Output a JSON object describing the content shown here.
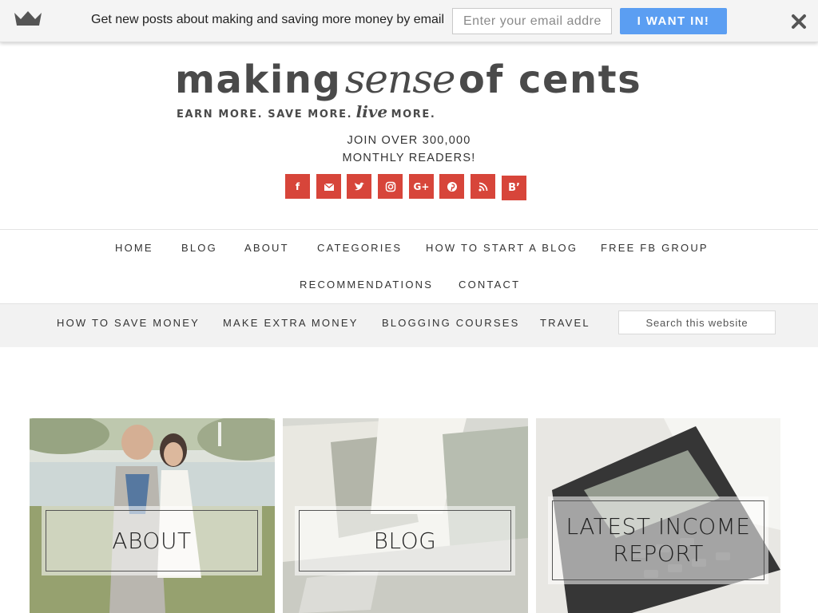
{
  "optin": {
    "text": "Get new posts about making and saving more money by email",
    "email_placeholder": "Enter your email address",
    "button_label": "I WANT IN!"
  },
  "logo": {
    "word1": "making",
    "word2": "sense",
    "word3": "of cents",
    "tag1": "EARN MORE. SAVE MORE.",
    "tag2": "live",
    "tag3": "MORE."
  },
  "readers": {
    "line1": "JOIN OVER 300,000",
    "line2": "MONTHLY READERS!"
  },
  "social": [
    {
      "icon": "facebook-icon",
      "text": "f"
    },
    {
      "icon": "email-icon",
      "text": ""
    },
    {
      "icon": "twitter-icon",
      "text": ""
    },
    {
      "icon": "instagram-icon",
      "text": ""
    },
    {
      "icon": "google-plus-icon",
      "text": "G+"
    },
    {
      "icon": "pinterest-icon",
      "text": ""
    },
    {
      "icon": "rss-icon",
      "text": ""
    },
    {
      "icon": "bloglovin-icon",
      "text": "B’"
    }
  ],
  "nav": {
    "home": "Home",
    "blog": "Blog",
    "about": "About",
    "categories": "Categories",
    "start_blog": "How to Start a Blog",
    "fb_group": "Free FB Group",
    "recommendations": "Recommendations",
    "contact": "Contact"
  },
  "subnav": {
    "save_money": "How to Save Money",
    "extra_money": "Make Extra Money",
    "courses": "Blogging Courses",
    "travel": "Travel",
    "search_placeholder": "Search this website"
  },
  "tiles": {
    "about": "ABOUT",
    "blog": "BLOG",
    "income_line1": "LATEST INCOME",
    "income_line2": "REPORT"
  },
  "colors": {
    "accent_button": "#5b9ef2",
    "social_red": "#d7453a",
    "logo_gray": "#4a4a4a"
  }
}
